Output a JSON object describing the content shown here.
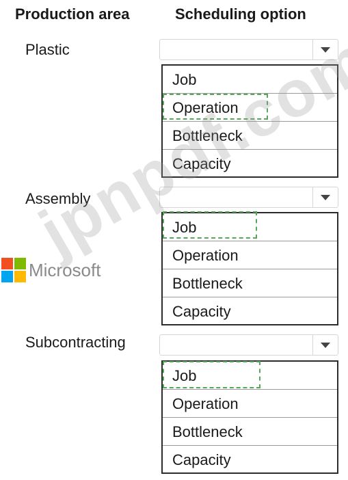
{
  "headers": {
    "area": "Production area",
    "option": "Scheduling option"
  },
  "rows": [
    {
      "area": "Plastic",
      "options": [
        "Job",
        "Operation",
        "Bottleneck",
        "Capacity"
      ],
      "marked": "Operation"
    },
    {
      "area": "Assembly",
      "options": [
        "Job",
        "Operation",
        "Bottleneck",
        "Capacity"
      ],
      "marked": "Job"
    },
    {
      "area": "Subcontracting",
      "options": [
        "Job",
        "Operation",
        "Bottleneck",
        "Capacity"
      ],
      "marked": "Job"
    }
  ],
  "brand": {
    "text": "Microsoft",
    "colors": [
      "#f25022",
      "#7fba00",
      "#00a4ef",
      "#ffb900"
    ]
  },
  "watermark": "jpnpdf.com",
  "colors": {
    "selection_dash": "#55a85a"
  }
}
